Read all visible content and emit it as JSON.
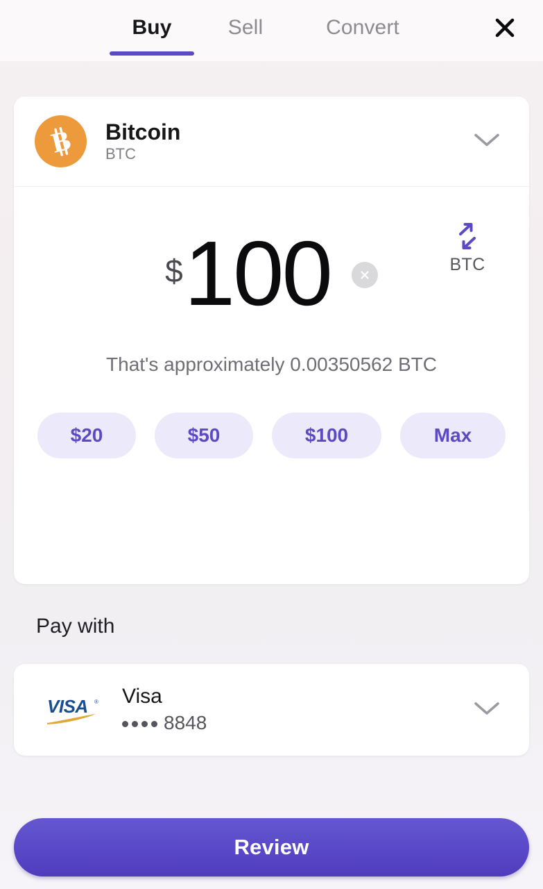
{
  "header": {
    "tabs": [
      {
        "label": "Buy",
        "active": true
      },
      {
        "label": "Sell",
        "active": false
      },
      {
        "label": "Convert",
        "active": false
      }
    ],
    "close_icon": "close-icon"
  },
  "asset": {
    "name": "Bitcoin",
    "symbol": "BTC",
    "logo_icon": "bitcoin-icon",
    "logo_color": "#ec9a3c",
    "chevron_icon": "chevron-down-icon"
  },
  "amount": {
    "currency_sign": "$",
    "value": "100",
    "clear_icon": "close-circle-icon",
    "swap_icon": "swap-arrows-icon",
    "swap_unit": "BTC",
    "swap_color": "#5b4ac4",
    "approx_text": "That's approximately 0.00350562 BTC"
  },
  "quick_amounts": [
    {
      "label": "$20"
    },
    {
      "label": "$50"
    },
    {
      "label": "$100"
    },
    {
      "label": "Max"
    }
  ],
  "payment": {
    "section_label": "Pay with",
    "brand": "Visa",
    "brand_icon": "visa-logo-icon",
    "masked_dots": 4,
    "last4": "8848",
    "chevron_icon": "chevron-down-icon"
  },
  "footer": {
    "review_label": "Review",
    "accent_color": "#5948c8"
  }
}
